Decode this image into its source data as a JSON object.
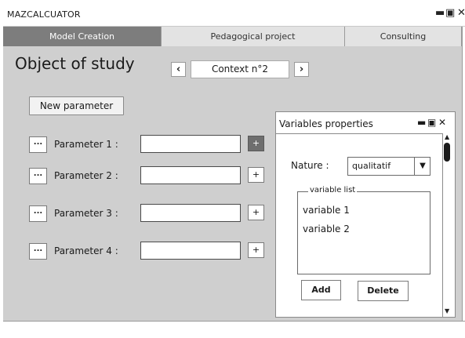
{
  "window": {
    "title": "MAZCALCUATOR",
    "controls": {
      "minimize": "▬",
      "maximize": "▣",
      "close": "✕"
    }
  },
  "tabs": [
    {
      "label": "Model Creation",
      "active": true
    },
    {
      "label": "Pedagogical project",
      "active": false
    },
    {
      "label": "Consulting",
      "active": false
    }
  ],
  "main": {
    "heading": "Object of study",
    "context": {
      "prev": "‹",
      "label": "Context n°2",
      "next": "›"
    },
    "new_parameter_label": "New parameter",
    "parameters": [
      {
        "dots": "...",
        "label": "Parameter 1 :",
        "value": "",
        "plus": "+",
        "plus_active": true
      },
      {
        "dots": "...",
        "label": "Parameter 2 :",
        "value": "",
        "plus": "+",
        "plus_active": false
      },
      {
        "dots": "...",
        "label": "Parameter 3 :",
        "value": "",
        "plus": "+",
        "plus_active": false
      },
      {
        "dots": "...",
        "label": "Parameter 4 :",
        "value": "",
        "plus": "+",
        "plus_active": false
      }
    ]
  },
  "panel": {
    "title": "Variables properties",
    "controls": {
      "minimize": "▬",
      "maximize": "▣",
      "close": "✕"
    },
    "nature_label": "Nature :",
    "nature_value": "qualitatif",
    "list_legend": "variable list",
    "variables": [
      "variable 1",
      "variable 2"
    ],
    "add_label": "Add",
    "delete_label": "Delete"
  },
  "colors": {
    "content_bg": "#cfcfcf",
    "active_tab": "#7d7d7d",
    "inactive_tab": "#e3e3e3"
  }
}
